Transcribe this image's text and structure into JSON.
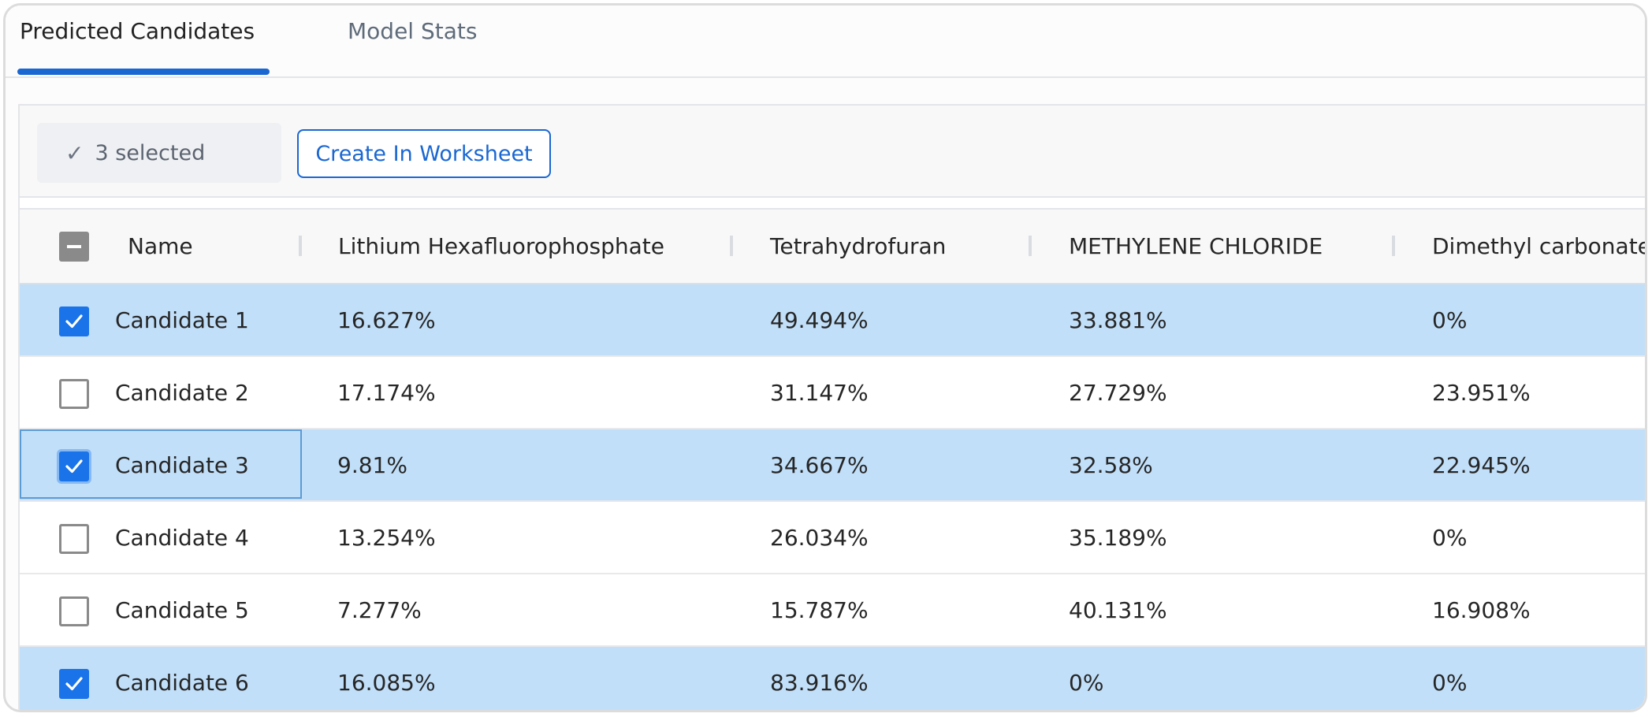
{
  "tabs": [
    {
      "label": "Predicted Candidates",
      "active": true
    },
    {
      "label": "Model Stats",
      "active": false
    }
  ],
  "toolbar": {
    "selected_label": "3 selected",
    "create_button_label": "Create In Worksheet"
  },
  "table": {
    "columns": [
      "Name",
      "Lithium Hexafluorophosphate",
      "Tetrahydrofuran",
      "METHYLENE CHLORIDE",
      "Dimethyl carbonate"
    ],
    "rows": [
      {
        "checked": true,
        "name": "Candidate 1",
        "values": [
          "16.627%",
          "49.494%",
          "33.881%",
          "0%"
        ]
      },
      {
        "checked": false,
        "name": "Candidate 2",
        "values": [
          "17.174%",
          "31.147%",
          "27.729%",
          "23.951%"
        ]
      },
      {
        "checked": true,
        "name": "Candidate 3",
        "values": [
          "9.81%",
          "34.667%",
          "32.58%",
          "22.945%"
        ]
      },
      {
        "checked": false,
        "name": "Candidate 4",
        "values": [
          "13.254%",
          "26.034%",
          "35.189%",
          "0%"
        ]
      },
      {
        "checked": false,
        "name": "Candidate 5",
        "values": [
          "7.277%",
          "15.787%",
          "40.131%",
          "16.908%"
        ]
      },
      {
        "checked": true,
        "name": "Candidate 6",
        "values": [
          "16.085%",
          "83.916%",
          "0%",
          "0%"
        ]
      }
    ]
  },
  "colors": {
    "accent": "#1a67d2",
    "selected_row": "#c1dff9",
    "checkbox_checked": "#1a73e8"
  }
}
